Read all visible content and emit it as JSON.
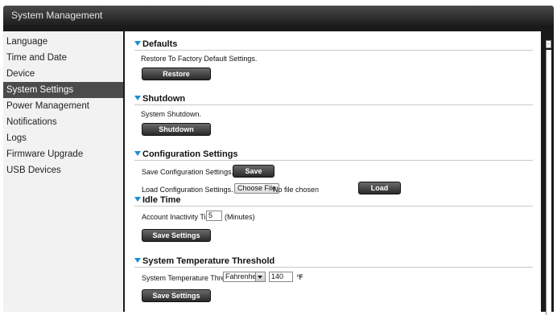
{
  "window": {
    "title": "System Management"
  },
  "sidebar": {
    "items": [
      {
        "label": "Language"
      },
      {
        "label": "Time and Date"
      },
      {
        "label": "Device"
      },
      {
        "label": "System Settings",
        "active": true
      },
      {
        "label": "Power Management"
      },
      {
        "label": "Notifications"
      },
      {
        "label": "Logs"
      },
      {
        "label": "Firmware Upgrade"
      },
      {
        "label": "USB Devices"
      }
    ]
  },
  "defaults": {
    "title": "Defaults",
    "description": "Restore To Factory Default Settings.",
    "button": "Restore"
  },
  "shutdown": {
    "title": "Shutdown",
    "description": "System Shutdown.",
    "button": "Shutdown"
  },
  "configuration": {
    "title": "Configuration Settings",
    "save_label": "Save Configuration Settings.",
    "save_button": "Save",
    "load_label": "Load Configuration Settings.",
    "choose_file": "Choose File",
    "file_status": "No file chosen",
    "load_button": "Load"
  },
  "idle_time": {
    "title": "Idle Time",
    "label": "Account Inactivity Timer",
    "value": "5",
    "unit": "(Minutes)",
    "button": "Save Settings"
  },
  "temperature": {
    "title": "System Temperature Threshold",
    "label": "System Temperature Threshold",
    "scale": "Fahrenheit",
    "value": "140",
    "unit": "℉",
    "button": "Save Settings"
  },
  "colors": {
    "accent": "#1a8fd6",
    "active_bg": "#4b4b4b",
    "titlebar": "#2f2f2f"
  }
}
